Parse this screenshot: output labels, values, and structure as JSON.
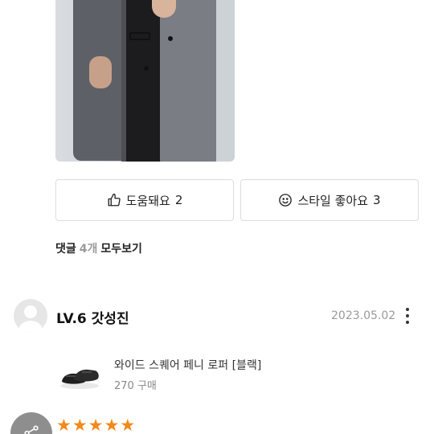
{
  "review": {
    "helpful_label": "도움돼요",
    "helpful_count": "2",
    "style_label": "스타일 좋아요",
    "style_count": "3"
  },
  "comments": {
    "label": "댓글",
    "count": "4개",
    "view_all": "모두보기"
  },
  "comment": {
    "username": "LV.6 갓성진",
    "date": "2023.05.02",
    "product_name": "와이드 스퀘어 페니 로퍼 [블랙]",
    "product_size": "270",
    "product_purchase": "구매",
    "rating": 5
  },
  "colors": {
    "star": "#f08a1a",
    "border": "#dcdcdc",
    "muted": "#999999"
  },
  "icons": [
    "thumbs-up-icon",
    "smile-icon",
    "more-vertical-icon",
    "share-icon",
    "star-icon"
  ]
}
